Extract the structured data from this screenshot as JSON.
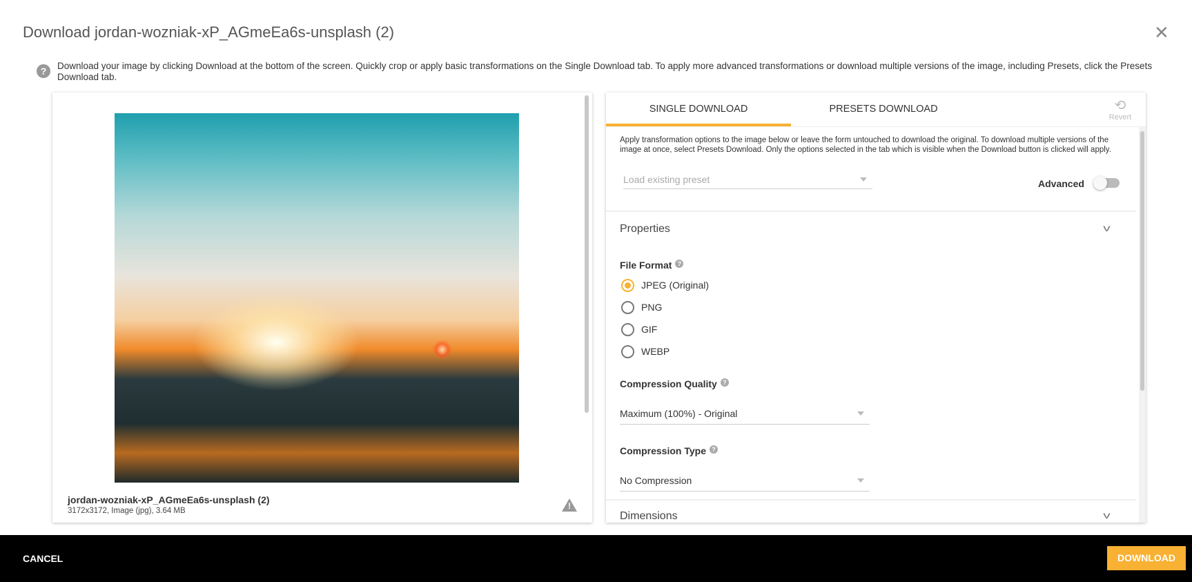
{
  "dialog": {
    "title": "Download jordan-wozniak-xP_AGmeEa6s-unsplash (2)",
    "close_icon": "close-icon",
    "intro": "Download your image by clicking Download at the bottom of the screen. Quickly crop or apply basic transformations on the Single Download tab. To apply more advanced transformations or download multiple versions of the image, including Presets, click the Presets Download tab."
  },
  "preview": {
    "file_name": "jordan-wozniak-xP_AGmeEa6s-unsplash (2)",
    "meta": "3172x3172, Image (jpg), 3.64 MB",
    "warning_icon": "warning-icon"
  },
  "tabs": [
    {
      "label": "SINGLE DOWNLOAD",
      "active": true
    },
    {
      "label": "PRESETS DOWNLOAD",
      "active": false
    }
  ],
  "revert_label": "Revert",
  "form": {
    "description": "Apply transformation options to the image below or leave the form untouched to download the original. To download multiple versions of the image at once, select Presets Download. Only the options selected in the tab which is visible when the Download button is clicked will apply.",
    "preset_placeholder": "Load existing preset",
    "advanced_label": "Advanced",
    "advanced_on": false,
    "properties_title": "Properties",
    "file_format_label": "File Format",
    "formats": [
      "JPEG (Original)",
      "PNG",
      "GIF",
      "WEBP"
    ],
    "selected_format": "JPEG (Original)",
    "compression_quality_label": "Compression Quality",
    "compression_quality_value": "Maximum (100%) - Original",
    "compression_type_label": "Compression Type",
    "compression_type_value": "No Compression",
    "dimensions_title": "Dimensions"
  },
  "footer": {
    "cancel": "CANCEL",
    "download": "DOWNLOAD"
  },
  "colors": {
    "accent": "#f8b133",
    "footer_bg": "#000000"
  }
}
